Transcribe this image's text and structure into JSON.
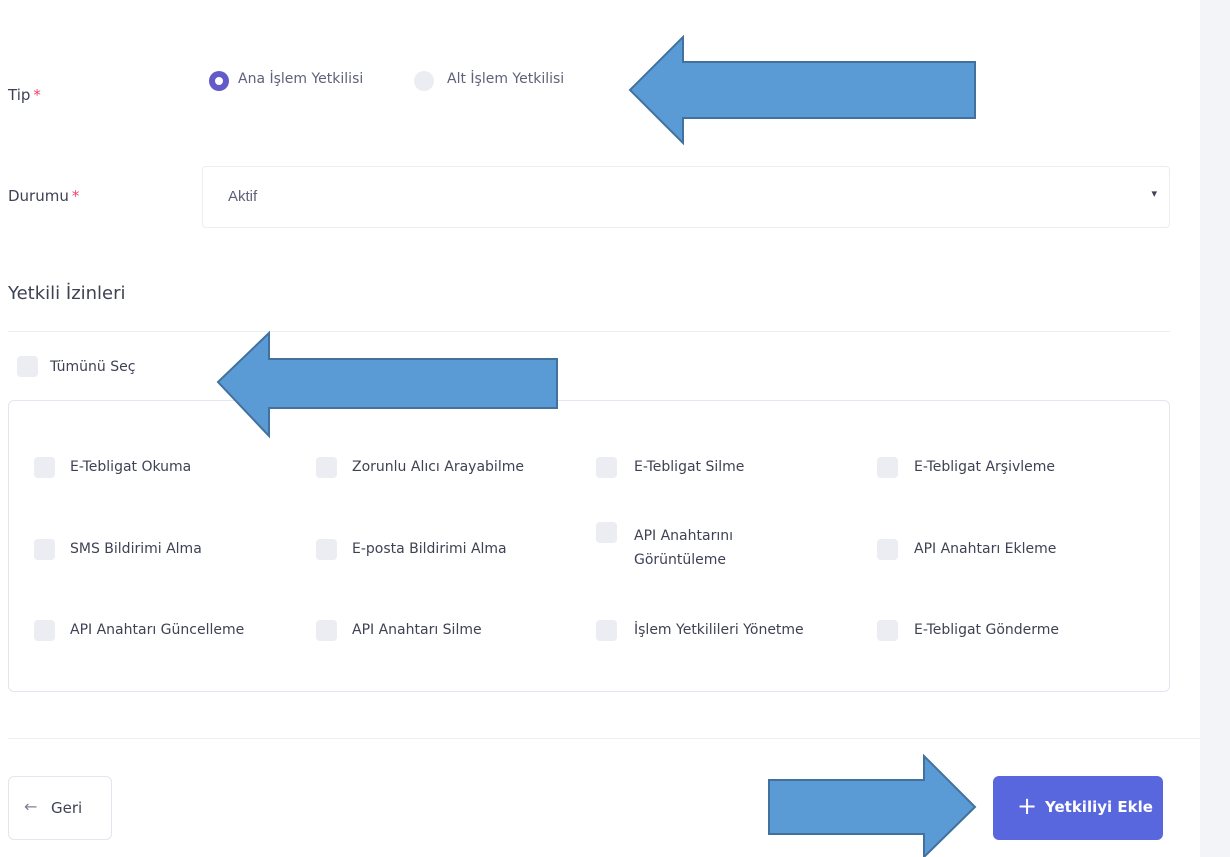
{
  "form": {
    "type_field": {
      "label": "Tip",
      "required_mark": "*",
      "options": [
        {
          "label": "Ana İşlem Yetkilisi",
          "selected": true
        },
        {
          "label": "Alt İşlem Yetkilisi",
          "selected": false
        }
      ]
    },
    "status_field": {
      "label": "Durumu",
      "required_mark": "*",
      "value": "Aktif",
      "caret": "▾"
    },
    "permissions": {
      "title": "Yetkili İzinleri",
      "select_all_label": "Tümünü Seç",
      "items": [
        "E-Tebligat Okuma",
        "Zorunlu Alıcı Arayabilme",
        "E-Tebligat Silme",
        "E-Tebligat Arşivleme",
        "SMS Bildirimi Alma",
        "E-posta Bildirimi Alma",
        "API Anahtarını Görüntüleme",
        "API Anahtarı Ekleme",
        "API Anahtarı Güncelleme",
        "API Anahtarı Silme",
        "İşlem Yetkilileri Yönetme",
        "E-Tebligat Gönderme"
      ]
    }
  },
  "footer": {
    "back_icon": "←",
    "back_label": "Geri",
    "add_icon": "+",
    "add_label": "Yetkiliyi Ekle"
  },
  "colors": {
    "primary": "#5867dd",
    "radio_checked": "#6259ca",
    "required": "#f1416c",
    "annotation_arrow": "#5b9bd5"
  },
  "icons": {
    "back": "arrow-left-icon",
    "add": "plus-icon",
    "caret": "chevron-down-icon",
    "annotations": "callout-arrow-icon"
  }
}
